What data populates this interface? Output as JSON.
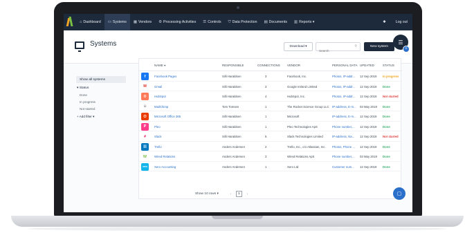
{
  "nav": {
    "items": [
      {
        "icon": "dashboard-icon",
        "glyph": "⌂",
        "label": "Dashboard"
      },
      {
        "icon": "systems-icon",
        "glyph": "▭",
        "label": "Systems"
      },
      {
        "icon": "vendors-icon",
        "glyph": "▦",
        "label": "Vendors"
      },
      {
        "icon": "processing-icon",
        "glyph": "⚙",
        "label": "Processing Activities"
      },
      {
        "icon": "controls-icon",
        "glyph": "☰",
        "label": "Controls"
      },
      {
        "icon": "data-protection-icon",
        "glyph": "⛉",
        "label": "Data Protection"
      },
      {
        "icon": "documents-icon",
        "glyph": "▤",
        "label": "Documents"
      },
      {
        "icon": "reports-icon",
        "glyph": "▥",
        "label": "Reports ▾"
      }
    ],
    "settings_glyph": "✱",
    "logout_label": "Log out"
  },
  "header": {
    "title": "Systems",
    "download_label": "Download ▾",
    "search_placeholder": "Search",
    "new_label": "New system"
  },
  "filters": {
    "show_all": "Show all systems",
    "group_label": "▾ Status",
    "options": [
      "Done",
      "In progress",
      "Not started"
    ],
    "add_filter": "+ Add filter ▾"
  },
  "table": {
    "columns": {
      "name": "NAME ▾",
      "responsible": "RESPONSIBLE",
      "connections": "CONNECTIONS",
      "vendor": "VENDOR",
      "personal_data": "PERSONAL DATA",
      "updated": "UPDATED",
      "status": "STATUS"
    },
    "rows": [
      {
        "logo": "facebook-logo",
        "glyph": "f",
        "bg": "#1877f2",
        "name": "Facebook Pages",
        "responsible": "Silli Haraldsen",
        "connections": "3",
        "vendor": "Facebook, Inc.",
        "personal_data": "Photos, IP-addr...",
        "updated": "12 Sep 2019",
        "status": "In progress",
        "status_color": "#f2a41e"
      },
      {
        "logo": "gmail-logo",
        "glyph": "M",
        "bg": "#ffffff",
        "fg": "#d93025",
        "name": "Gmail",
        "responsible": "Silli Haraldsen",
        "connections": "3",
        "vendor": "Google Ireland Limited",
        "personal_data": "Photos, IP-addr...",
        "updated": "12 Sep 2019",
        "status": "Done",
        "status_color": "#3cb371"
      },
      {
        "logo": "hubspot-logo",
        "glyph": "⚙",
        "bg": "#ff7a59",
        "name": "HubSpot",
        "responsible": "Silli Haraldsen",
        "connections": "4",
        "vendor": "HubSpot, Inc.",
        "personal_data": "Photos, IP-addr...",
        "updated": "12 Sep 2019",
        "status": "Not started",
        "status_color": "#e03e3e"
      },
      {
        "logo": "mailchimp-logo",
        "glyph": "☺",
        "bg": "#ffffff",
        "fg": "#241c15",
        "name": "MailChimp",
        "responsible": "Tom Tomsen",
        "connections": "1",
        "vendor": "The Rocket Science Group LLC",
        "personal_data": "IP-address, E-m...",
        "updated": "03 May 2019",
        "status": "Done",
        "status_color": "#3cb371"
      },
      {
        "logo": "office365-logo",
        "glyph": "O",
        "bg": "#eb3c00",
        "name": "Microsoft Office 365",
        "responsible": "Silli Haraldsen",
        "connections": "1",
        "vendor": "Microsoft",
        "personal_data": "IP-address, E-m...",
        "updated": "12 Sep 2019",
        "status": "Done",
        "status_color": "#3cb371"
      },
      {
        "logo": "pleo-logo",
        "glyph": "P",
        "bg": "#ff3d8b",
        "name": "Pleo",
        "responsible": "Silli Haraldsen",
        "connections": "1",
        "vendor": "Pleo Technologies ApS",
        "personal_data": "Phone number,...",
        "updated": "12 Sep 2019",
        "status": "Done",
        "status_color": "#3cb371"
      },
      {
        "logo": "slack-logo",
        "glyph": "#",
        "bg": "#ffffff",
        "fg": "#e01e5a",
        "name": "Slack",
        "responsible": "Silli Haraldsen",
        "connections": "5",
        "vendor": "Slack Technologies Limited",
        "personal_data": "IP-address, Na...",
        "updated": "12 Sep 2019",
        "status": "Not started",
        "status_color": "#e03e3e"
      },
      {
        "logo": "trello-logo",
        "glyph": "▥",
        "bg": "#0079bf",
        "name": "Trello",
        "responsible": "Anders Andersen",
        "connections": "2",
        "vendor": "Trello, Inc., c/o Atlassian, Inc.",
        "personal_data": "Photos, Phone ...",
        "updated": "12 Sep 2019",
        "status": "Done",
        "status_color": "#3cb371"
      },
      {
        "logo": "wired-relations-logo",
        "glyph": "W",
        "bg": "#ffffff",
        "fg": "#79c043",
        "name": "Wired Relations",
        "responsible": "Anders Andersen",
        "connections": "3",
        "vendor": "Wired Relations ApS",
        "personal_data": "Phone number,...",
        "updated": "03 May 2019",
        "status": "Done",
        "status_color": "#3cb371"
      },
      {
        "logo": "xero-logo",
        "glyph": "xero",
        "bg": "#13b5ea",
        "name": "Xero Accounting",
        "responsible": "Anders Andersen",
        "connections": "1",
        "vendor": "Xero Ltd",
        "personal_data": "Customer num...",
        "updated": "12 Sep 2019",
        "status": "Done",
        "status_color": "#3cb371"
      }
    ]
  },
  "pagination": {
    "rows_label": "Show 10 rows ▾",
    "prev": "‹",
    "current": "1",
    "next": "›"
  },
  "fab": {
    "menu_glyph": "☰",
    "plus_glyph": "+",
    "chat_glyph": "▢"
  }
}
